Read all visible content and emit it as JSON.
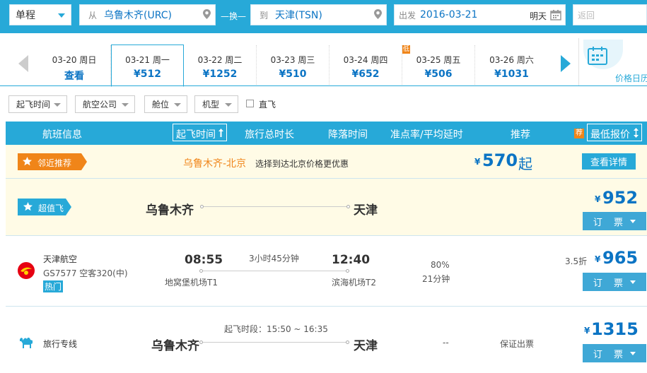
{
  "search": {
    "trip_type": "单程",
    "from_label": "从",
    "from_value": "乌鲁木齐(URC)",
    "swap": "—换—",
    "to_label": "到",
    "to_value": "天津(TSN)",
    "depart_label": "出发",
    "depart_date": "2016-03-21",
    "depart_hint": "明天",
    "return_placeholder": "返回"
  },
  "dates": [
    {
      "day": "03-20 周日",
      "price": "查看"
    },
    {
      "day": "03-21 周一",
      "price": "¥512",
      "selected": true
    },
    {
      "day": "03-22 周二",
      "price": "¥1252"
    },
    {
      "day": "03-23 周三",
      "price": "¥510"
    },
    {
      "day": "03-24 周四",
      "price": "¥652"
    },
    {
      "day": "03-25 周五",
      "price": "¥506",
      "badge": "低"
    },
    {
      "day": "03-26 周六",
      "price": "¥1031"
    }
  ],
  "calendar_label": "价格日历",
  "filters": {
    "depart_time": "起飞时间",
    "airline": "航空公司",
    "cabin": "舱位",
    "aircraft": "机型",
    "direct": "直飞"
  },
  "header": {
    "info": "航班信息",
    "depart_time": "起飞时间",
    "duration": "旅行总时长",
    "arrive_time": "降落时间",
    "ontime": "准点率/平均延时",
    "recommend": "推荐",
    "badge": "荐",
    "lowest": "最低报价"
  },
  "nearby": {
    "tag": "邻近推荐",
    "route": "乌鲁木齐-北京",
    "desc": "选择到达北京价格更优惠",
    "yen": "¥",
    "price": "570",
    "suffix": "起",
    "button": "查看详情"
  },
  "deal": {
    "tag": "超值飞",
    "from": "乌鲁木齐",
    "to": "天津",
    "yen": "¥",
    "price": "952",
    "button": "订 票"
  },
  "flight": {
    "airline": "天津航空",
    "number": "GS7577 空客320(中)",
    "hot": "热门",
    "depart": "08:55",
    "duration": "3小时45分钟",
    "arrive": "12:40",
    "depart_airport": "地窝堡机场T1",
    "arrive_airport": "滨海机场T2",
    "ontime": "80%",
    "delay": "21分钟",
    "discount": "3.5折",
    "yen": "¥",
    "price": "965",
    "button": "订 票"
  },
  "travel": {
    "name": "旅行专线",
    "window": "起飞时段：15:50 ~ 16:35",
    "from": "乌鲁木齐",
    "to": "天津",
    "ontime": "--",
    "guarantee": "保证出票",
    "yen": "¥",
    "price": "1315",
    "button": "订 票"
  },
  "colors": {
    "accent": "#27a9d8",
    "price": "#0b74c4",
    "orange": "#f08519",
    "deal_bg": "#fffbe6"
  }
}
